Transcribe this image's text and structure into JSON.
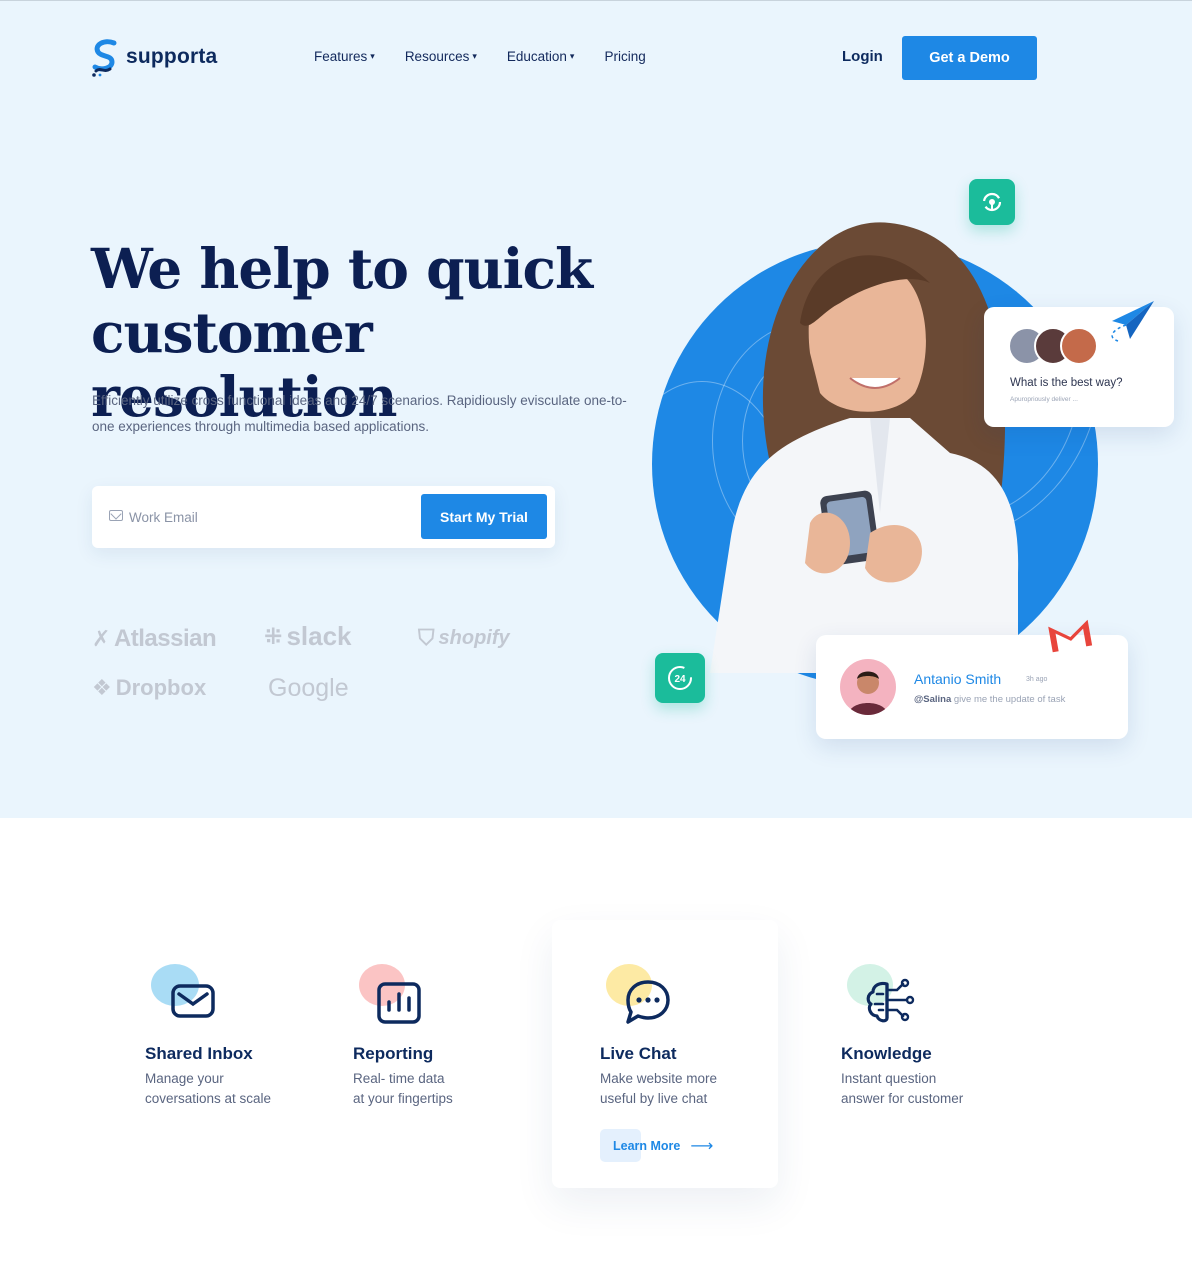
{
  "brand": {
    "name": "supporta"
  },
  "nav": {
    "items": [
      {
        "label": "Features",
        "caret": "▾"
      },
      {
        "label": "Resources",
        "caret": "▾"
      },
      {
        "label": "Education",
        "caret": "▾"
      },
      {
        "label": "Pricing"
      }
    ],
    "login": "Login",
    "demo": "Get a Demo"
  },
  "hero": {
    "title_line1": "We help to quick",
    "title_line2": "customer resolution",
    "subtitle": "Efficiently utilize cross functional ideas and 24/7 scenarios. Rapidiously evisculate one-to-one experiences through multimedia based applications.",
    "email_placeholder": "Work Email",
    "cta": "Start My Trial"
  },
  "brands": [
    "Atlassian",
    "slack",
    "shopify",
    "Dropbox",
    "Google"
  ],
  "illustration": {
    "question_card": {
      "title": "What is the best way?",
      "sub": "Apuropriously deliver ..."
    },
    "message_card": {
      "name": "Antanio Smith",
      "time": "3h ago",
      "mention": "@Salina",
      "text": "give me the update of task"
    },
    "badge_24": "24"
  },
  "features": [
    {
      "title": "Shared Inbox",
      "desc": "Manage your\ncoversations at scale",
      "icon": "mail-icon",
      "blob": "#a9dcf5"
    },
    {
      "title": "Reporting",
      "desc": "Real- time data\nat your fingertips",
      "icon": "bar-chart-icon",
      "blob": "#fbc4c4"
    },
    {
      "title": "Live Chat",
      "desc": "Make website more\nuseful by live chat",
      "icon": "chat-bubble-icon",
      "blob": "#fdeaa4"
    },
    {
      "title": "Knowledge",
      "desc": "Instant question\nanswer for customer",
      "icon": "brain-circuit-icon",
      "blob": "#d3f2e6"
    }
  ],
  "learn_more": "Learn More",
  "colors": {
    "primary": "#1e88e5",
    "navy": "#0d2a5e",
    "teal": "#1bbc9b",
    "hero_bg": "#eaf5fd"
  }
}
